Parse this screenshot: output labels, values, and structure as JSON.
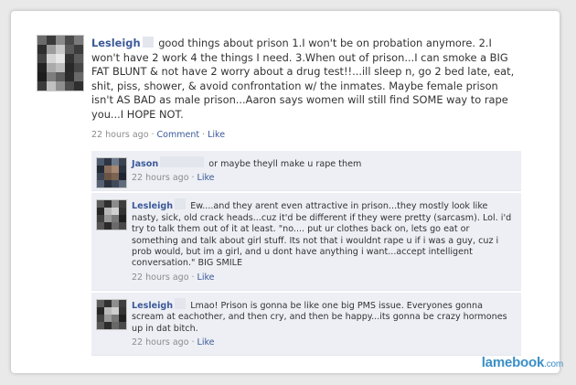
{
  "post": {
    "author": "Lesleigh",
    "text": "good things about prison 1.I won't be on probation anymore. 2.I won't have 2 work 4 the things I need. 3.When out of prison...I can smoke a BIG FAT BLUNT & not have 2 worry about a drug test!!...ill sleep n, go 2 bed late, eat, shit, piss, shower, & avoid confrontation w/ the inmates. Maybe female prison isn't AS BAD as male prison...Aaron says women will still find SOME way to rape you...I HOPE NOT.",
    "time": "22 hours ago",
    "comment_label": "Comment",
    "like_label": "Like"
  },
  "comments": [
    {
      "author": "Jason",
      "text": "or maybe theyll make u rape them",
      "time": "22 hours ago",
      "like_label": "Like"
    },
    {
      "author": "Lesleigh",
      "text": "Ew....and they arent even attractive in prison...they mostly look like nasty, sick, old crack heads...cuz it'd be different if they were pretty (sarcasm). Lol. i'd try to talk them out of it at least. \"no.... put ur clothes back on, lets go eat or something and talk about girl stuff. Its not that i wouldnt rape u if i was a guy, cuz i prob would, but im a girl, and u dont have anything i want...accept intelligent conversation.\" BIG SMILE",
      "time": "22 hours ago",
      "like_label": "Like"
    },
    {
      "author": "Lesleigh",
      "text": "Lmao! Prison is gonna be like one big PMS issue. Everyones gonna scream at eachother, and then cry, and then be happy...its gonna be crazy hormones up in dat bitch.",
      "time": "22 hours ago",
      "like_label": "Like"
    }
  ],
  "watermark": {
    "brand": "lamebook",
    "tld": ".com"
  },
  "colors": {
    "link": "#3b5998",
    "comment_bg": "#edeff4",
    "watermark": "#3a8fc8"
  }
}
